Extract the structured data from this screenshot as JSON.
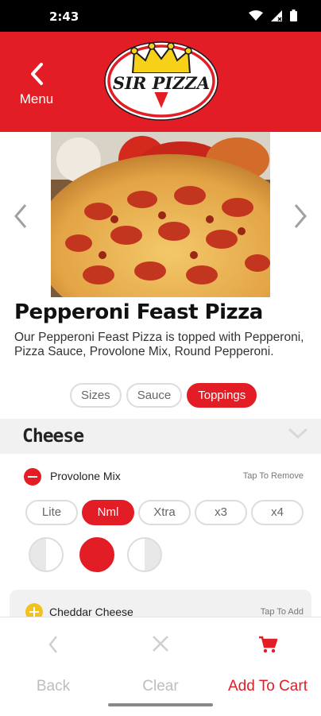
{
  "status_bar": {
    "time": "2:43"
  },
  "header": {
    "menu_label": "Menu",
    "logo_text": "SIR PIZZA"
  },
  "product": {
    "title": "Pepperoni Feast Pizza",
    "description": "Our Pepperoni Feast Pizza is topped with Pepperoni, Pizza Sauce, Provolone Mix, Round Pepperoni."
  },
  "tabs": [
    {
      "label": "Sizes",
      "active": false
    },
    {
      "label": "Sauce",
      "active": false
    },
    {
      "label": "Toppings",
      "active": true
    }
  ],
  "section": {
    "title": "Cheese"
  },
  "toppings": [
    {
      "name": "Provolone Mix",
      "action_hint": "Tap To Remove",
      "selected": true,
      "amounts": [
        "Lite",
        "Nml",
        "Xtra",
        "x3",
        "x4"
      ],
      "selected_amount": "Nml",
      "portions": [
        "left-half",
        "whole",
        "right-half"
      ],
      "selected_portion": "whole"
    },
    {
      "name": "Cheddar Cheese",
      "action_hint": "Tap To Add",
      "selected": false
    }
  ],
  "bottom_bar": {
    "back_label": "Back",
    "clear_label": "Clear",
    "add_to_cart_label": "Add To Cart"
  },
  "colors": {
    "brand_red": "#e31d25",
    "add_yellow": "#f4c21f",
    "disabled_gray": "#bdbdbd"
  },
  "icons": [
    "wifi-icon",
    "signal-icon",
    "battery-icon",
    "chevron-left-icon",
    "chevron-right-icon",
    "chevron-down-icon",
    "minus-circle-icon",
    "plus-circle-icon",
    "close-icon",
    "cart-icon"
  ]
}
